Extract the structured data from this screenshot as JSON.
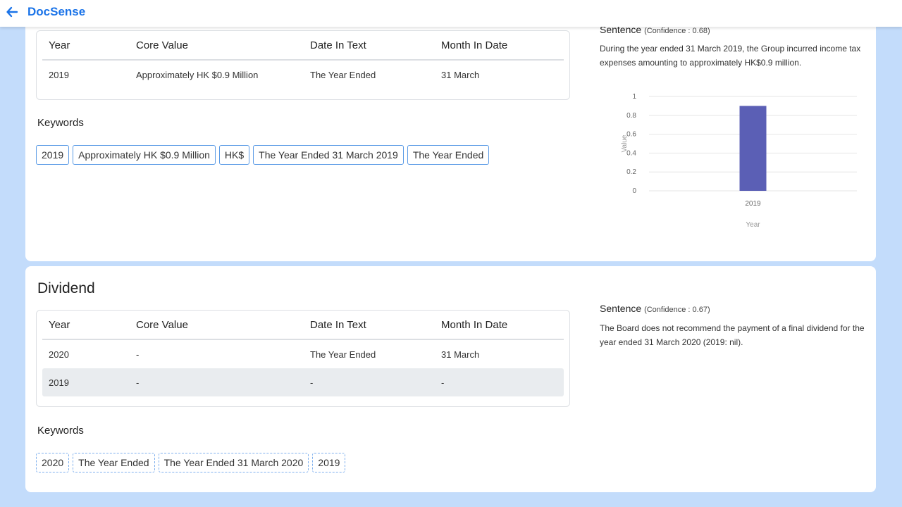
{
  "header": {
    "title": "DocSense",
    "back_icon": "arrow-left-icon"
  },
  "tax_section": {
    "table": {
      "headers": [
        "Year",
        "Core Value",
        "Date In Text",
        "Month In Date"
      ],
      "rows": [
        [
          "2019",
          "Approximately HK $0.9 Million",
          "The Year Ended",
          "31 March"
        ]
      ]
    },
    "keywords_title": "Keywords",
    "keywords": [
      "2019",
      "Approximately HK $0.9 Million",
      "HK$",
      "The Year Ended 31 March 2019",
      "The Year Ended"
    ],
    "sentence": {
      "title": "Sentence",
      "confidence": "(Confidence : 0.68)",
      "text": "During the year ended 31 March 2019, the Group incurred income tax expenses amounting to approximately HK$0.9 million."
    },
    "chart_data": {
      "type": "bar",
      "categories": [
        "2019"
      ],
      "values": [
        0.9
      ],
      "xlabel": "Year",
      "ylabel": "Value",
      "ylim": [
        0,
        1
      ],
      "yticks": [
        "1",
        "0.8",
        "0.6",
        "0.4",
        "0.2",
        "0"
      ],
      "bar_color": "#5b5fb5",
      "grid": true
    }
  },
  "dividend_section": {
    "title": "Dividend",
    "table": {
      "headers": [
        "Year",
        "Core Value",
        "Date In Text",
        "Month In Date"
      ],
      "rows": [
        [
          "2020",
          "-",
          "The Year Ended",
          "31 March"
        ],
        [
          "2019",
          "-",
          "-",
          "-"
        ]
      ]
    },
    "keywords_title": "Keywords",
    "keywords": [
      "2020",
      "The Year Ended",
      "The Year Ended 31 March 2020",
      "2019"
    ],
    "sentence": {
      "title": "Sentence",
      "confidence": "(Confidence : 0.67)",
      "text": "The Board does not recommend the payment of a final dividend for the year ended 31 March 2020 (2019: nil)."
    }
  },
  "colors": {
    "accent": "#1a73e8",
    "background": "#c3dcfb",
    "tag_border": "#5b9be6"
  }
}
